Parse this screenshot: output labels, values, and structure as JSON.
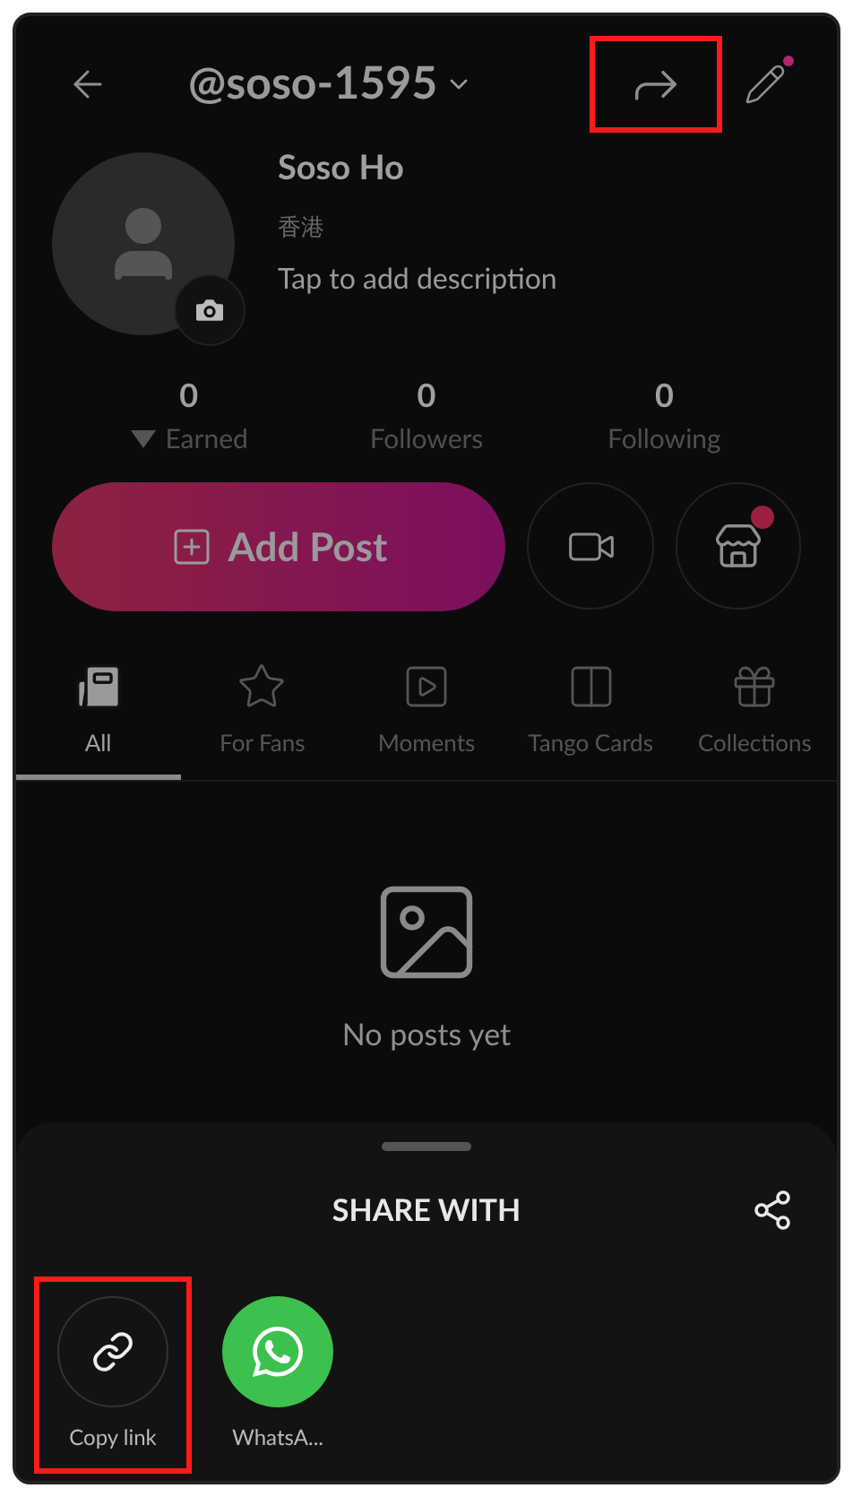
{
  "header": {
    "username": "@soso-1595",
    "share_highlighted": true,
    "edit_badge": true
  },
  "profile": {
    "name": "Soso Ho",
    "location": "香港",
    "description": "Tap to add description"
  },
  "stats": [
    {
      "kind": "earned",
      "value": "0",
      "label": "Earned"
    },
    {
      "kind": "plain",
      "value": "0",
      "label": "Followers"
    },
    {
      "kind": "plain",
      "value": "0",
      "label": "Following"
    }
  ],
  "actions": {
    "add_post": "Add Post",
    "store_badge": true
  },
  "tabs": [
    {
      "kind": "all",
      "label": "All",
      "selected": true
    },
    {
      "kind": "fans",
      "label": "For Fans",
      "selected": false
    },
    {
      "kind": "moments",
      "label": "Moments",
      "selected": false
    },
    {
      "kind": "cards",
      "label": "Tango Cards",
      "selected": false
    },
    {
      "kind": "collections",
      "label": "Collections",
      "selected": false
    }
  ],
  "empty_state": "No posts yet",
  "share_sheet": {
    "title": "SHARE WITH",
    "targets": [
      {
        "kind": "link",
        "label": "Copy link",
        "highlighted": true
      },
      {
        "kind": "whatsapp",
        "label": "WhatsA...",
        "highlighted": false
      }
    ]
  }
}
